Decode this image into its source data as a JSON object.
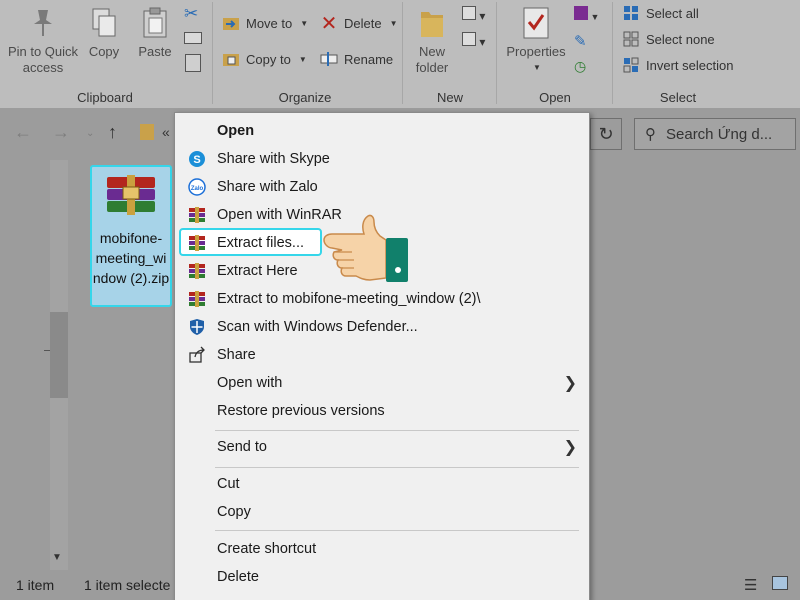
{
  "ribbon": {
    "clipboard": {
      "group_label": "Clipboard",
      "pin_label_1": "Pin to Quick",
      "pin_label_2": "access",
      "copy_label": "Copy",
      "paste_label": "Paste"
    },
    "organize": {
      "group_label": "Organize",
      "move_to": "Move to",
      "copy_to": "Copy to",
      "delete": "Delete",
      "rename": "Rename"
    },
    "new": {
      "group_label": "New",
      "new_folder_1": "New",
      "new_folder_2": "folder"
    },
    "open": {
      "group_label": "Open",
      "properties": "Properties"
    },
    "select": {
      "group_label": "Select",
      "select_all": "Select all",
      "select_none": "Select none",
      "invert_selection": "Invert selection"
    }
  },
  "address": {
    "breadcrumb": "«",
    "search_placeholder": "Search Ứng d..."
  },
  "file": {
    "name": "mobifone-meeting_window (2).zip"
  },
  "status": {
    "item_count": "1 item",
    "selected": "1 item selecte"
  },
  "context_menu": {
    "items": [
      {
        "label": "Open",
        "icon": "none"
      },
      {
        "label": "Share with Skype",
        "icon": "skype-icon"
      },
      {
        "label": "Share with Zalo",
        "icon": "zalo-icon"
      },
      {
        "label": "Open with WinRAR",
        "icon": "winrar-icon"
      },
      {
        "label": "Extract files...",
        "icon": "winrar-icon"
      },
      {
        "label": "Extract Here",
        "icon": "winrar-icon"
      },
      {
        "label": "Extract to mobifone-meeting_window (2)\\",
        "icon": "winrar-icon"
      },
      {
        "label": "Scan with Windows Defender...",
        "icon": "shield-icon"
      },
      {
        "label": "Share",
        "icon": "share-icon"
      },
      {
        "label": "Open with",
        "icon": "none"
      },
      {
        "label": "Restore previous versions",
        "icon": "none"
      },
      {
        "label": "Send to",
        "icon": "none"
      },
      {
        "label": "Cut",
        "icon": "none"
      },
      {
        "label": "Copy",
        "icon": "none"
      },
      {
        "label": "Create shortcut",
        "icon": "none"
      },
      {
        "label": "Delete",
        "icon": "none"
      }
    ]
  },
  "colors": {
    "highlight_border": "#35d6ea",
    "overlay_bg": "#9c9c9c",
    "menu_bg": "#f0f0f0"
  }
}
